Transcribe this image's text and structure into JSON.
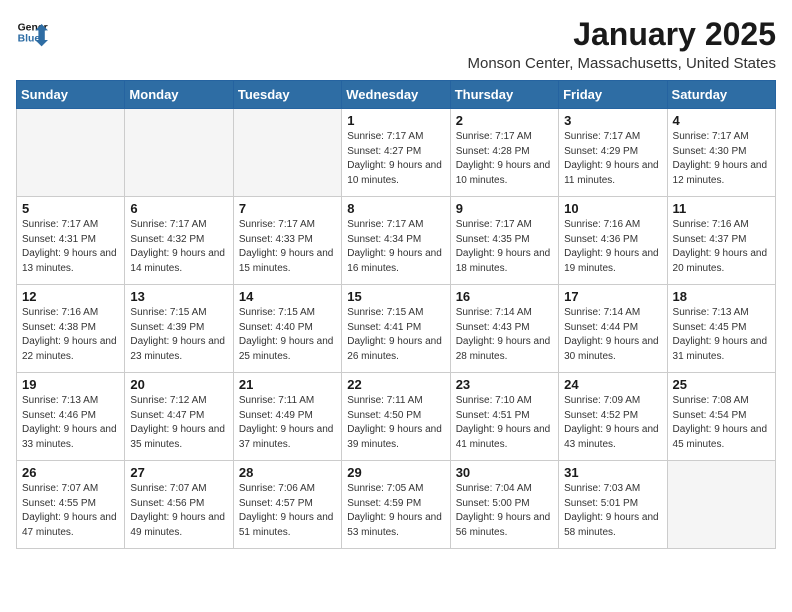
{
  "header": {
    "logo_line1": "General",
    "logo_line2": "Blue",
    "month": "January 2025",
    "location": "Monson Center, Massachusetts, United States"
  },
  "days_of_week": [
    "Sunday",
    "Monday",
    "Tuesday",
    "Wednesday",
    "Thursday",
    "Friday",
    "Saturday"
  ],
  "weeks": [
    [
      {
        "day": "",
        "empty": true
      },
      {
        "day": "",
        "empty": true
      },
      {
        "day": "",
        "empty": true
      },
      {
        "day": "1",
        "sunrise": "7:17 AM",
        "sunset": "4:27 PM",
        "daylight": "9 hours and 10 minutes."
      },
      {
        "day": "2",
        "sunrise": "7:17 AM",
        "sunset": "4:28 PM",
        "daylight": "9 hours and 10 minutes."
      },
      {
        "day": "3",
        "sunrise": "7:17 AM",
        "sunset": "4:29 PM",
        "daylight": "9 hours and 11 minutes."
      },
      {
        "day": "4",
        "sunrise": "7:17 AM",
        "sunset": "4:30 PM",
        "daylight": "9 hours and 12 minutes."
      }
    ],
    [
      {
        "day": "5",
        "sunrise": "7:17 AM",
        "sunset": "4:31 PM",
        "daylight": "9 hours and 13 minutes."
      },
      {
        "day": "6",
        "sunrise": "7:17 AM",
        "sunset": "4:32 PM",
        "daylight": "9 hours and 14 minutes."
      },
      {
        "day": "7",
        "sunrise": "7:17 AM",
        "sunset": "4:33 PM",
        "daylight": "9 hours and 15 minutes."
      },
      {
        "day": "8",
        "sunrise": "7:17 AM",
        "sunset": "4:34 PM",
        "daylight": "9 hours and 16 minutes."
      },
      {
        "day": "9",
        "sunrise": "7:17 AM",
        "sunset": "4:35 PM",
        "daylight": "9 hours and 18 minutes."
      },
      {
        "day": "10",
        "sunrise": "7:16 AM",
        "sunset": "4:36 PM",
        "daylight": "9 hours and 19 minutes."
      },
      {
        "day": "11",
        "sunrise": "7:16 AM",
        "sunset": "4:37 PM",
        "daylight": "9 hours and 20 minutes."
      }
    ],
    [
      {
        "day": "12",
        "sunrise": "7:16 AM",
        "sunset": "4:38 PM",
        "daylight": "9 hours and 22 minutes."
      },
      {
        "day": "13",
        "sunrise": "7:15 AM",
        "sunset": "4:39 PM",
        "daylight": "9 hours and 23 minutes."
      },
      {
        "day": "14",
        "sunrise": "7:15 AM",
        "sunset": "4:40 PM",
        "daylight": "9 hours and 25 minutes."
      },
      {
        "day": "15",
        "sunrise": "7:15 AM",
        "sunset": "4:41 PM",
        "daylight": "9 hours and 26 minutes."
      },
      {
        "day": "16",
        "sunrise": "7:14 AM",
        "sunset": "4:43 PM",
        "daylight": "9 hours and 28 minutes."
      },
      {
        "day": "17",
        "sunrise": "7:14 AM",
        "sunset": "4:44 PM",
        "daylight": "9 hours and 30 minutes."
      },
      {
        "day": "18",
        "sunrise": "7:13 AM",
        "sunset": "4:45 PM",
        "daylight": "9 hours and 31 minutes."
      }
    ],
    [
      {
        "day": "19",
        "sunrise": "7:13 AM",
        "sunset": "4:46 PM",
        "daylight": "9 hours and 33 minutes."
      },
      {
        "day": "20",
        "sunrise": "7:12 AM",
        "sunset": "4:47 PM",
        "daylight": "9 hours and 35 minutes."
      },
      {
        "day": "21",
        "sunrise": "7:11 AM",
        "sunset": "4:49 PM",
        "daylight": "9 hours and 37 minutes."
      },
      {
        "day": "22",
        "sunrise": "7:11 AM",
        "sunset": "4:50 PM",
        "daylight": "9 hours and 39 minutes."
      },
      {
        "day": "23",
        "sunrise": "7:10 AM",
        "sunset": "4:51 PM",
        "daylight": "9 hours and 41 minutes."
      },
      {
        "day": "24",
        "sunrise": "7:09 AM",
        "sunset": "4:52 PM",
        "daylight": "9 hours and 43 minutes."
      },
      {
        "day": "25",
        "sunrise": "7:08 AM",
        "sunset": "4:54 PM",
        "daylight": "9 hours and 45 minutes."
      }
    ],
    [
      {
        "day": "26",
        "sunrise": "7:07 AM",
        "sunset": "4:55 PM",
        "daylight": "9 hours and 47 minutes."
      },
      {
        "day": "27",
        "sunrise": "7:07 AM",
        "sunset": "4:56 PM",
        "daylight": "9 hours and 49 minutes."
      },
      {
        "day": "28",
        "sunrise": "7:06 AM",
        "sunset": "4:57 PM",
        "daylight": "9 hours and 51 minutes."
      },
      {
        "day": "29",
        "sunrise": "7:05 AM",
        "sunset": "4:59 PM",
        "daylight": "9 hours and 53 minutes."
      },
      {
        "day": "30",
        "sunrise": "7:04 AM",
        "sunset": "5:00 PM",
        "daylight": "9 hours and 56 minutes."
      },
      {
        "day": "31",
        "sunrise": "7:03 AM",
        "sunset": "5:01 PM",
        "daylight": "9 hours and 58 minutes."
      },
      {
        "day": "",
        "empty": true
      }
    ]
  ]
}
